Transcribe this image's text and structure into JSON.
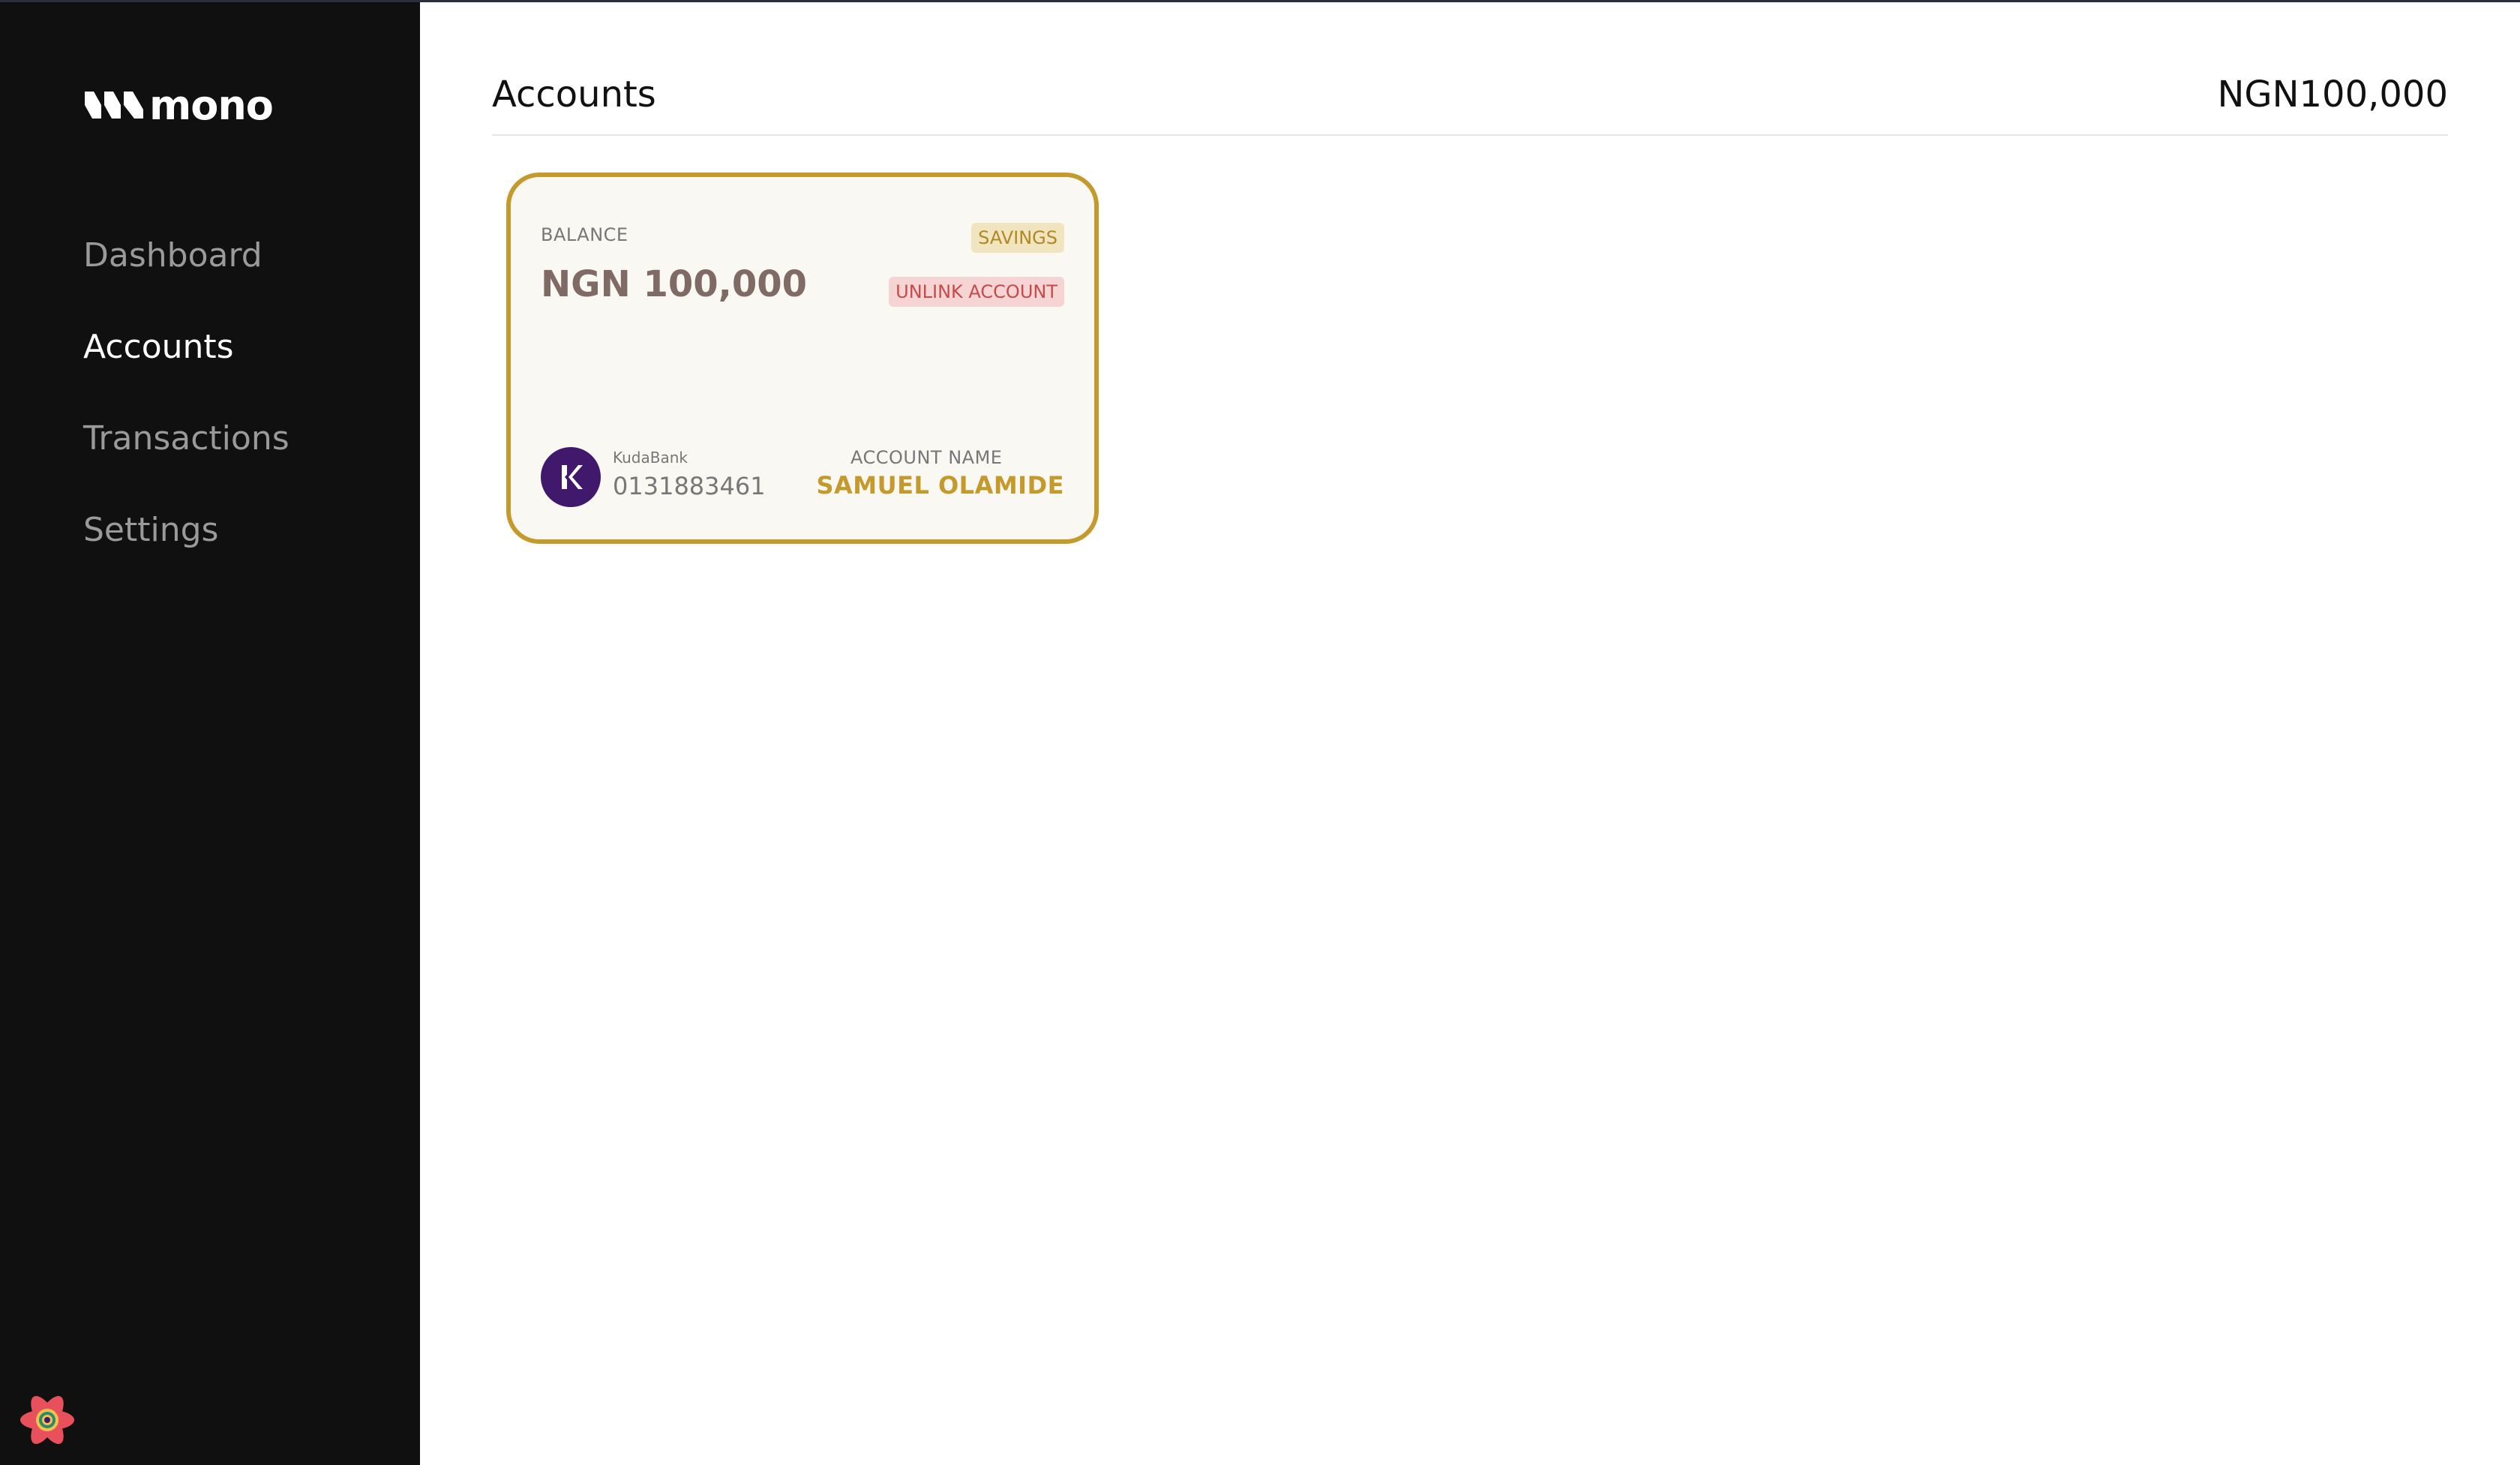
{
  "app": {
    "brand": "mono"
  },
  "sidebar": {
    "items": [
      {
        "label": "Dashboard",
        "active": false
      },
      {
        "label": "Accounts",
        "active": true
      },
      {
        "label": "Transactions",
        "active": false
      },
      {
        "label": "Settings",
        "active": false
      }
    ]
  },
  "header": {
    "title": "Accounts",
    "total": "NGN100,000"
  },
  "account_card": {
    "balance_label": "BALANCE",
    "balance": "NGN 100,000",
    "type_badge": "SAVINGS",
    "unlink_label": "UNLINK ACCOUNT",
    "bank_name": "KudaBank",
    "account_number": "0131883461",
    "account_name_label": "ACCOUNT NAME",
    "account_name": "SAMUEL OLAMIDE"
  },
  "colors": {
    "sidebar_bg": "#101010",
    "accent_gold": "#c49a2c",
    "bank_purple": "#40196d",
    "danger": "#c74a4a"
  },
  "icons": {
    "logo": "mono-wave-logo",
    "bank": "kuda-k-icon",
    "devtools": "react-logo-icon"
  }
}
